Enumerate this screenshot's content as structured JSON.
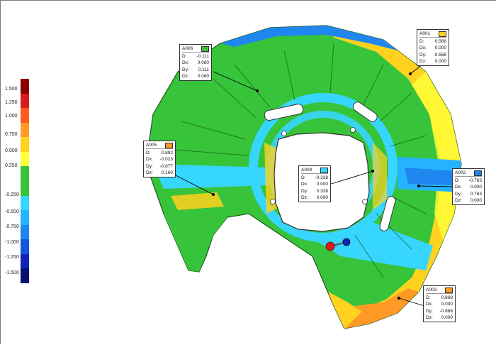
{
  "color_scale": {
    "bands": [
      "#8b0000",
      "#d61c1c",
      "#ff5a1f",
      "#ff9a26",
      "#ffd21f",
      "#ffff3a",
      "#37c43a",
      "#37c43a",
      "#37d6ff",
      "#25b3ff",
      "#1f86f0",
      "#1356dc",
      "#1024b8",
      "#06106e"
    ],
    "labels": [
      "1.500",
      "1.250",
      "1.000",
      "0.750",
      "0.500",
      "0.250",
      "-0.250",
      "-0.500",
      "-0.750",
      "-1.000",
      "-1.250",
      "-1.500"
    ]
  },
  "annotations": [
    {
      "id": "A006",
      "swatch": "#37c43a",
      "d": "-0.111",
      "dx": "0.080",
      "dy": "0.111",
      "dz": "0.080"
    },
    {
      "id": "A001",
      "swatch": "#ffd21f",
      "d": "0.568",
      "dx": "0.000",
      "dy": "-0.568",
      "dz": "0.000"
    },
    {
      "id": "A005",
      "swatch": "#ff9a26",
      "d": "0.892",
      "dx": "-0.023",
      "dy": "-0.877",
      "dz": "0.160"
    },
    {
      "id": "A004",
      "swatch": "#37d6ff",
      "d": "-0.338",
      "dx": "0.000",
      "dy": "0.338",
      "dz": "0.000"
    },
    {
      "id": "A002",
      "swatch": "#1f86f0",
      "d": "-0.763",
      "dx": "0.000",
      "dy": "0.763",
      "dz": "0.000"
    },
    {
      "id": "A003",
      "swatch": "#ff9a26",
      "d": "0.868",
      "dx": "0.000",
      "dy": "-0.868",
      "dz": "0.000"
    }
  ],
  "labels": {
    "d": "D:",
    "dx": "Dx:",
    "dy": "Dy:",
    "dz": "Dz:"
  }
}
